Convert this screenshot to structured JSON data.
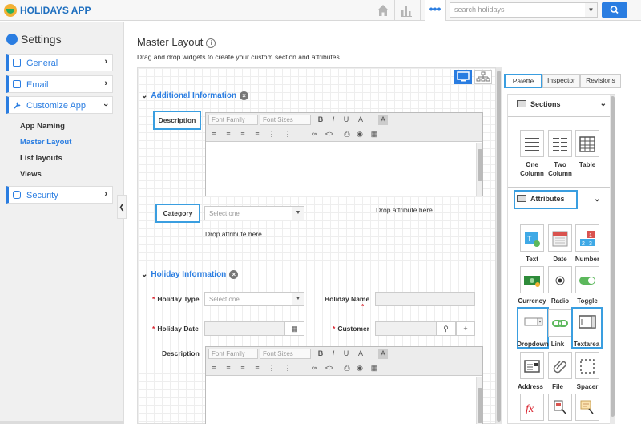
{
  "app": {
    "title": "HOLIDAYS APP"
  },
  "topbar": {
    "search_placeholder": "search holidays",
    "more_icon": "•••"
  },
  "sidebar": {
    "title": "Settings",
    "nav": [
      {
        "label": "General",
        "icon": "general-icon"
      },
      {
        "label": "Email",
        "icon": "email-icon"
      },
      {
        "label": "Customize App",
        "icon": "wrench-icon",
        "expanded": true
      },
      {
        "label": "Security",
        "icon": "lock-icon"
      }
    ],
    "subitems": [
      {
        "label": "App Naming",
        "active": false
      },
      {
        "label": "Master Layout",
        "active": true
      },
      {
        "label": "List layouts",
        "active": false
      },
      {
        "label": "Views",
        "active": false
      }
    ]
  },
  "main": {
    "title": "Master Layout",
    "subtitle": "Drag and drop widgets to create your custom section and attributes",
    "sections": [
      {
        "title": "Additional Information",
        "fields": {
          "description_label": "Description",
          "category_label": "Category",
          "category_placeholder": "Select one",
          "drop_hint_1": "Drop attribute here",
          "drop_hint_2": "Drop attribute here"
        }
      },
      {
        "title": "Holiday Information",
        "fields": {
          "holiday_type_label": "Holiday Type",
          "holiday_type_placeholder": "Select one",
          "holiday_name_label": "Holiday Name",
          "holiday_date_label": "Holiday Date",
          "customer_label": "Customer",
          "description_label": "Description"
        }
      }
    ],
    "editor": {
      "font_family": "Font Family",
      "font_sizes": "Font Sizes"
    }
  },
  "palette": {
    "tabs": [
      "Palette",
      "Inspector",
      "Revisions"
    ],
    "active_tab": "Palette",
    "groups": [
      {
        "title": "Sections",
        "items": [
          {
            "label": "One Column",
            "icon": "one-column-icon"
          },
          {
            "label": "Two Column",
            "icon": "two-column-icon"
          },
          {
            "label": "Table",
            "icon": "table-icon"
          }
        ]
      },
      {
        "title": "Attributes",
        "items": [
          {
            "label": "Text",
            "icon": "text-icon"
          },
          {
            "label": "Date",
            "icon": "calendar-icon"
          },
          {
            "label": "Number",
            "icon": "number-icon"
          },
          {
            "label": "Currency",
            "icon": "currency-icon"
          },
          {
            "label": "Radio",
            "icon": "radio-icon"
          },
          {
            "label": "Toggle",
            "icon": "toggle-icon"
          },
          {
            "label": "Dropdown",
            "icon": "dropdown-icon"
          },
          {
            "label": "Link",
            "icon": "link-icon"
          },
          {
            "label": "Textarea",
            "icon": "textarea-icon"
          },
          {
            "label": "Address",
            "icon": "address-icon"
          },
          {
            "label": "File",
            "icon": "paperclip-icon"
          },
          {
            "label": "Spacer",
            "icon": "spacer-icon"
          },
          {
            "label": "",
            "icon": "formula-icon"
          },
          {
            "label": "",
            "icon": "lookup-icon"
          },
          {
            "label": "",
            "icon": "signature-icon"
          }
        ]
      }
    ]
  },
  "colors": {
    "accent": "#2a7de1",
    "highlight": "#3a9ee0",
    "required": "#d9232e"
  }
}
